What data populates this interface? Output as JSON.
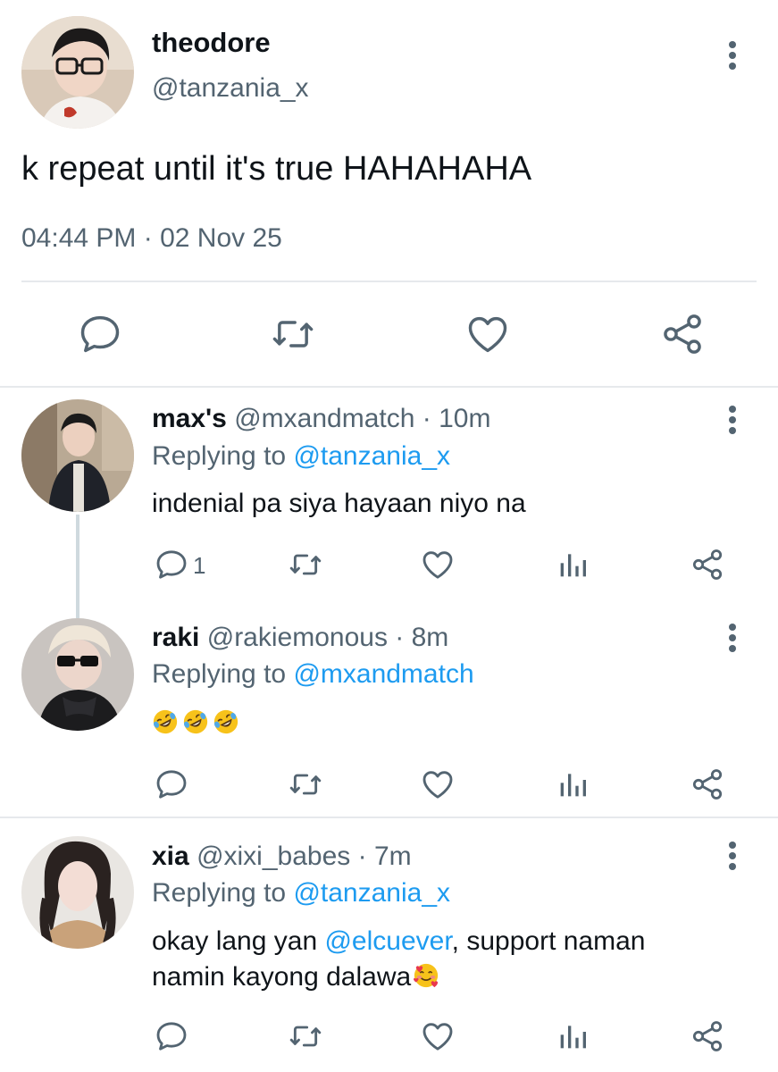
{
  "main_tweet": {
    "name": "theodore",
    "handle": "@tanzania_x",
    "text": "k repeat until it's true HAHAHAHA",
    "timestamp": "04:44 PM · 02 Nov 25",
    "actions": [
      "reply-icon",
      "retweet-icon",
      "like-icon",
      "share-icon"
    ]
  },
  "replies": [
    {
      "name": "max's",
      "handle": "@mxandmatch",
      "time_sep": " · ",
      "time": "10m",
      "replying_prefix": "Replying to ",
      "replying_to": "@tanzania_x",
      "text": "indenial pa siya hayaan niyo na",
      "reply_count": "1"
    },
    {
      "name": "raki",
      "handle": "@rakiemonous",
      "time_sep": " · ",
      "time": "8m",
      "replying_prefix": "Replying to ",
      "replying_to": "@mxandmatch",
      "emojis": [
        "rolling-on-floor-laughing",
        "rolling-on-floor-laughing",
        "rolling-on-floor-laughing"
      ],
      "reply_count": ""
    },
    {
      "name": "xia",
      "handle": "@xixi_babes",
      "time_sep": " · ",
      "time": "7m",
      "replying_prefix": "Replying to ",
      "replying_to": "@tanzania_x",
      "text_before": "okay lang yan ",
      "mention": "@elcuever",
      "text_after": ", support naman namin kayong dalawa",
      "trailing_emoji": "smiling-face-with-hearts",
      "reply_count": ""
    }
  ],
  "colors": {
    "text_primary": "#0f1419",
    "text_secondary": "#536471",
    "link": "#1d9bf0",
    "divider": "#e6e9ec"
  }
}
